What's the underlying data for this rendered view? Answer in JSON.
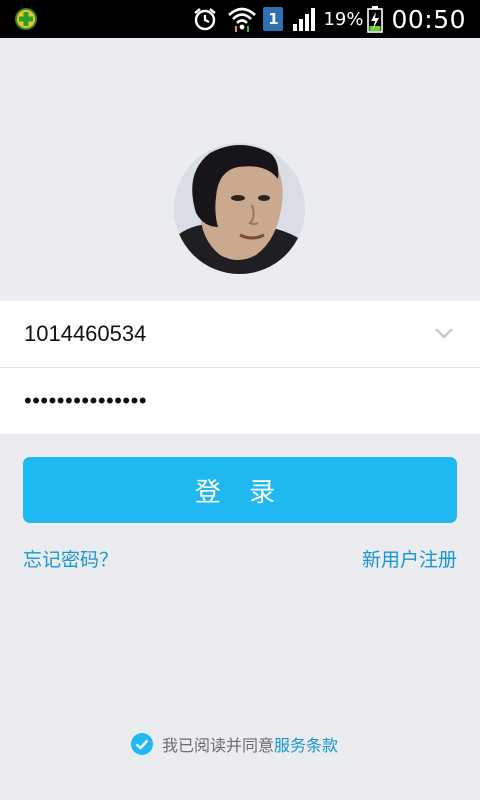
{
  "status_bar": {
    "icons": [
      "app-cross-icon",
      "alarm-icon",
      "wifi-icon",
      "notification-1-icon",
      "signal-icon",
      "battery-charging-icon"
    ],
    "notification_count": "1",
    "battery_percent": "19%",
    "time": "00:50"
  },
  "profile": {
    "avatar": "user-avatar-photo"
  },
  "form": {
    "account_value": "1014460534",
    "password_value": "•••••••••••••••",
    "dropdown_icon": "chevron-down-icon"
  },
  "login_button": {
    "label": "登 录"
  },
  "links": {
    "forgot_password": "忘记密码？",
    "register": "新用户注册"
  },
  "agreement": {
    "checked": true,
    "text": "我已阅读并同意",
    "link": "服务条款"
  },
  "colors": {
    "background": "#ebecf0",
    "accent": "#1fb8f0",
    "link": "#1597d8"
  }
}
